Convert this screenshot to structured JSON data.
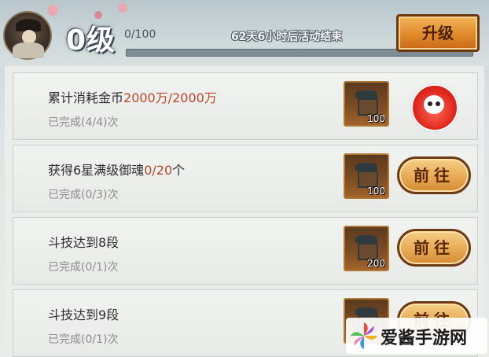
{
  "header": {
    "level": "0级",
    "progress": "0/100",
    "progress_fraction": 0,
    "countdown": "62天6小时后活动结束",
    "upgrade_label": "升级"
  },
  "tasks": [
    {
      "title_prefix": "累计消耗金币",
      "title_highlight": "2000万/2000万",
      "title_suffix": "",
      "status": "已完成(4/4)次",
      "reward_count": "100",
      "action": "daruma-icon"
    },
    {
      "title_prefix": "获得6星满级御魂",
      "title_highlight": "0/20",
      "title_suffix": "个",
      "status": "已完成(0/3)次",
      "reward_count": "100",
      "action_label": "前往"
    },
    {
      "title_prefix": "斗技达到8段",
      "title_highlight": "",
      "title_suffix": "",
      "status": "已完成(0/1)次",
      "reward_count": "200",
      "action_label": "前往"
    },
    {
      "title_prefix": "斗技达到9段",
      "title_highlight": "",
      "title_suffix": "",
      "status": "已完成(0/1)次",
      "reward_count": "",
      "action_label": "前往"
    }
  ],
  "watermark": {
    "text": "爱酱手游网"
  },
  "colors": {
    "highlight": "#b8472a",
    "button": "#e6a650",
    "accent": "#e0b04a"
  }
}
